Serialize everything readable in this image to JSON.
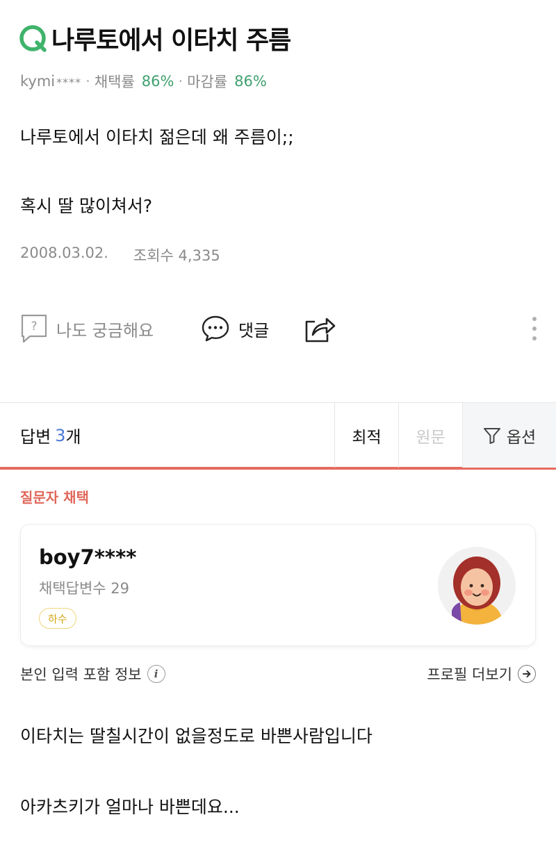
{
  "question": {
    "title": "나루토에서 이타치 주름",
    "author": "kymi",
    "author_mask": "****",
    "adoption_label": "채택률",
    "adoption_rate": "86%",
    "close_label": "마감률",
    "close_rate": "86%",
    "body_line1": "나루토에서 이타치 젊은데 왜 주름이;;",
    "body_line2": "혹시 딸 많이쳐서?",
    "date": "2008.03.02.",
    "views": "조회수 4,335"
  },
  "actions": {
    "curious_label": "나도 궁금해요",
    "comment_label": "댓글"
  },
  "answers": {
    "label": "답변",
    "count": "3",
    "unit": "개",
    "sort_best": "최적",
    "sort_original": "원문",
    "option_label": "옵션"
  },
  "chosen_label": "질문자 채택",
  "answerer": {
    "name": "boy7****",
    "adopted_count": "채택답변수 29",
    "grade": "하수",
    "info_label": "본인 입력 포함 정보",
    "profile_more": "프로필 더보기"
  },
  "answer_body": {
    "line1": "이타치는 딸칠시간이 없을정도로 바쁜사람입니다",
    "line2": "아카츠키가 얼마나 바쁜데요..."
  },
  "colors": {
    "brand_green": "#3fa06e",
    "accent_red": "#e56a5e",
    "count_blue": "#4a78d6"
  }
}
